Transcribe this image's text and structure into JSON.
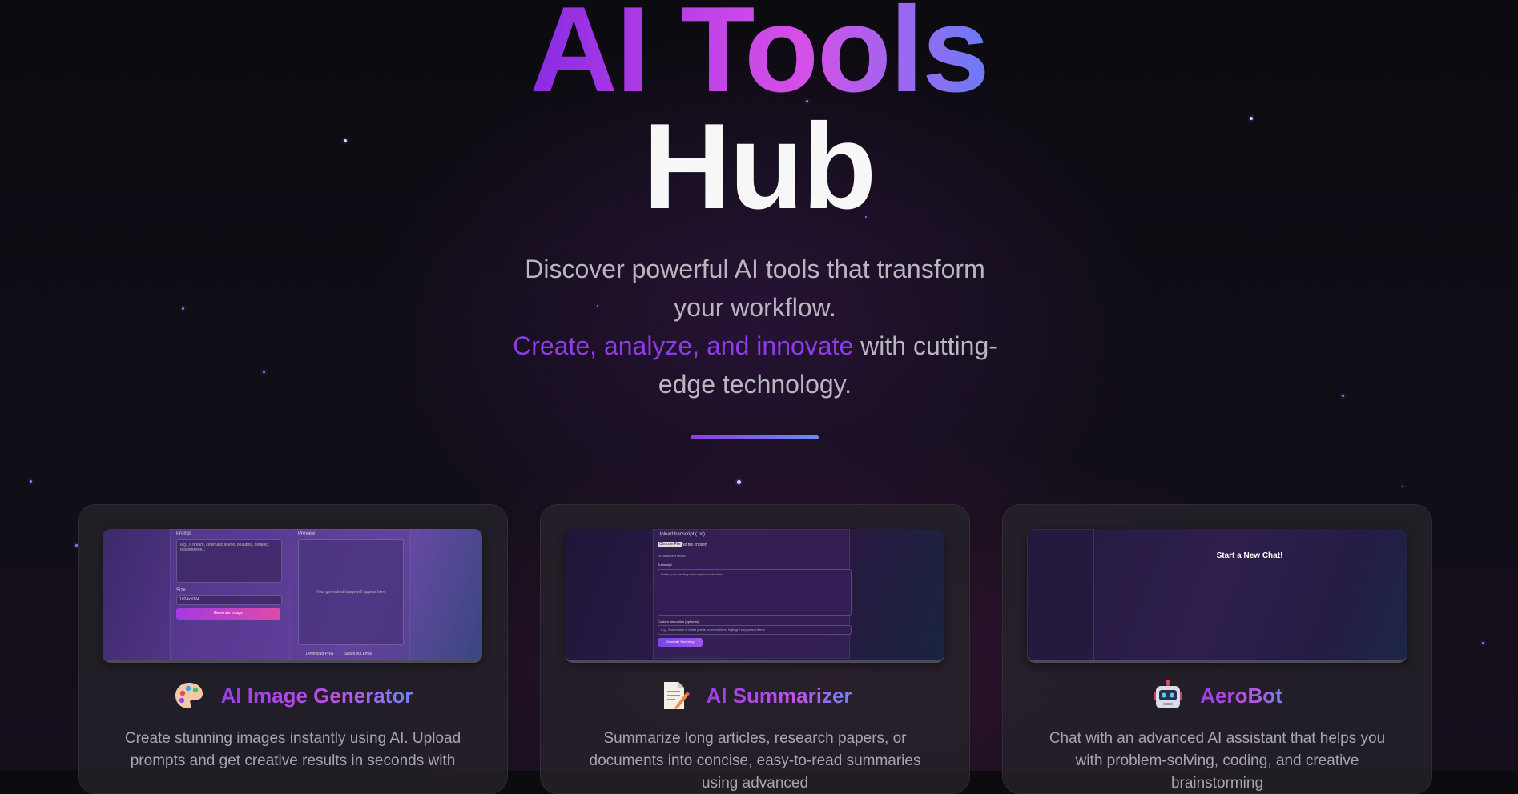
{
  "hero": {
    "title_line1": "AI Tools",
    "title_line2": "Hub",
    "subtitle_part1": "Discover powerful AI tools that transform your workflow.",
    "subtitle_highlight": "Create, analyze, and innovate",
    "subtitle_part2": " with cutting-edge technology."
  },
  "cards": [
    {
      "title": "AI Image Generator",
      "icon": "palette-icon",
      "description": "Create stunning images instantly using AI. Upload prompts and get creative results in seconds with",
      "preview": {
        "prompt_label": "Prompt",
        "prompt_placeholder": "e.g., a dream, cinematic scene, beautiful, detailed, masterpiece...",
        "size_label": "Size",
        "size_value": "1024x1024",
        "generate_label": "Generate Image",
        "preview_label": "Preview",
        "preview_placeholder": "Your generated image will appear here",
        "download_label": "Download PNG",
        "share_label": "Share via Email"
      }
    },
    {
      "title": "AI Summarizer",
      "icon": "memo-icon",
      "description": "Summarize long articles, research papers, or documents into concise, easy-to-read summaries using advanced",
      "preview": {
        "upload_label": "Upload transcript (.txt)",
        "choose_file_label": "Choose File",
        "no_file_label": "No file chosen",
        "or_label": "Or paste text below",
        "textarea_label": "Transcript",
        "textarea_placeholder": "Paste your meeting transcript or notes here...",
        "instruction_label": "Custom instruction (optional)",
        "instruction_placeholder": "e.g., Summarize in bullet points for executives, highlight only action items",
        "button_label": "Generate Summary"
      }
    },
    {
      "title": "AeroBot",
      "icon": "robot-icon",
      "description": "Chat with an advanced AI assistant that helps you with problem-solving, coding, and creative brainstorming",
      "preview": {
        "heading": "Start a New Chat!"
      }
    }
  ],
  "colors": {
    "accent_purple": "#8e3be8",
    "accent_pink": "#d450e6",
    "accent_blue": "#6b7cf5",
    "background": "#0c0b10"
  }
}
